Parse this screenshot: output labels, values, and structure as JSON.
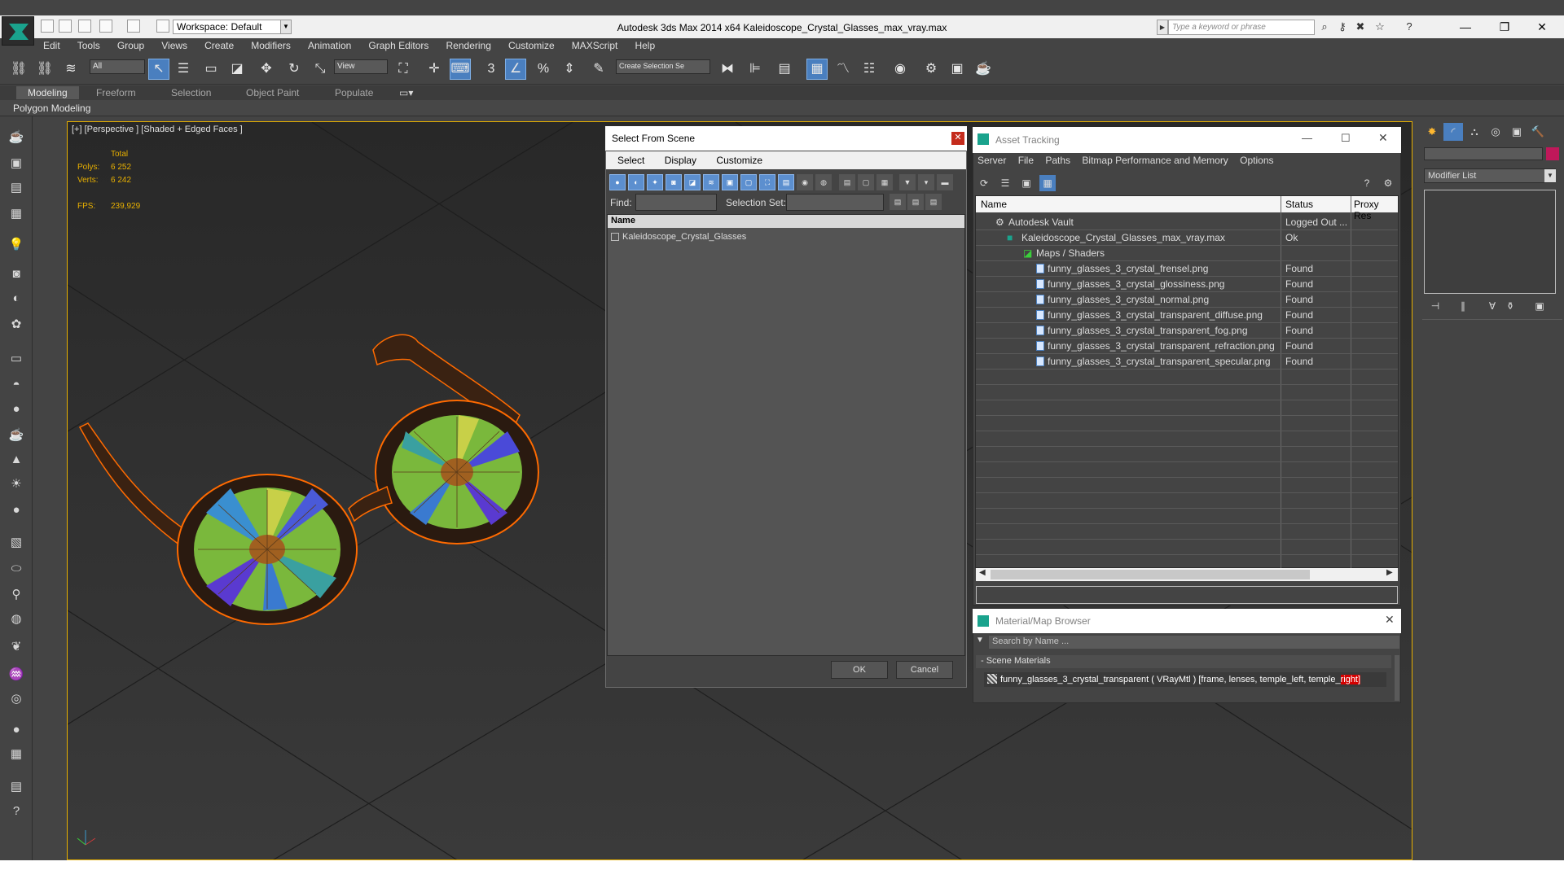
{
  "window": {
    "title": "Autodesk 3ds Max  2014 x64    Kaleidoscope_Crystal_Glasses_max_vray.max",
    "workspace": "Workspace: Default",
    "search_placeholder": "Type a keyword or phrase",
    "min_icon": "minimize-icon",
    "max_icon": "restore-icon",
    "close_icon": "close-icon"
  },
  "menu": [
    "Edit",
    "Tools",
    "Group",
    "Views",
    "Create",
    "Modifiers",
    "Animation",
    "Graph Editors",
    "Rendering",
    "Customize",
    "MAXScript",
    "Help"
  ],
  "toolbar": {
    "filter_value": "All",
    "ref_coord": "View",
    "selection_set_placeholder": "Create Selection Se"
  },
  "ribbon": {
    "tabs": [
      "Modeling",
      "Freeform",
      "Selection",
      "Object Paint",
      "Populate"
    ],
    "active_tab": "Modeling",
    "subpanel": "Polygon Modeling"
  },
  "viewport": {
    "label": "[+] [Perspective ] [Shaded + Edged Faces ]",
    "stats": {
      "total_label": "Total",
      "polys_label": "Polys:",
      "polys_value": "6 252",
      "verts_label": "Verts:",
      "verts_value": "6 242",
      "fps_label": "FPS:",
      "fps_value": "239,929"
    }
  },
  "select_from_scene": {
    "title": "Select From Scene",
    "menu": [
      "Select",
      "Display",
      "Customize"
    ],
    "find_label": "Find:",
    "selection_set_label": "Selection Set:",
    "column_name": "Name",
    "items": [
      "Kaleidoscope_Crystal_Glasses"
    ],
    "ok": "OK",
    "cancel": "Cancel"
  },
  "asset_tracking": {
    "title": "Asset Tracking",
    "menu": [
      "Server",
      "File",
      "Paths",
      "Bitmap Performance and Memory",
      "Options"
    ],
    "columns": [
      "Name",
      "Status",
      "Proxy Res"
    ],
    "rows": [
      {
        "name": "Autodesk Vault",
        "status": "Logged Out ...",
        "indent": 0
      },
      {
        "name": "Kaleidoscope_Crystal_Glasses_max_vray.max",
        "status": "Ok",
        "indent": 1
      },
      {
        "name": "Maps / Shaders",
        "status": "",
        "indent": 2
      },
      {
        "name": "funny_glasses_3_crystal_frensel.png",
        "status": "Found",
        "indent": 3
      },
      {
        "name": "funny_glasses_3_crystal_glossiness.png",
        "status": "Found",
        "indent": 3
      },
      {
        "name": "funny_glasses_3_crystal_normal.png",
        "status": "Found",
        "indent": 3
      },
      {
        "name": "funny_glasses_3_crystal_transparent_diffuse.png",
        "status": "Found",
        "indent": 3
      },
      {
        "name": "funny_glasses_3_crystal_transparent_fog.png",
        "status": "Found",
        "indent": 3
      },
      {
        "name": "funny_glasses_3_crystal_transparent_refraction.png",
        "status": "Found",
        "indent": 3
      },
      {
        "name": "funny_glasses_3_crystal_transparent_specular.png",
        "status": "Found",
        "indent": 3
      }
    ]
  },
  "material_browser": {
    "title": "Material/Map Browser",
    "search_placeholder": "Search by Name ...",
    "group": "- Scene Materials",
    "item_main": "funny_glasses_3_crystal_transparent  ( VRayMtl ) [frame, lenses, temple_left, temple_",
    "item_highlight": "right]",
    "highlight_color": "#d40000"
  },
  "command_panel": {
    "modifier_list": "Modifier List",
    "object_color": "#c0185a"
  },
  "colors": {
    "accent_blue": "#4a7fbf",
    "viewport_border": "#e8b000",
    "wire_orange": "#ff6a00"
  }
}
